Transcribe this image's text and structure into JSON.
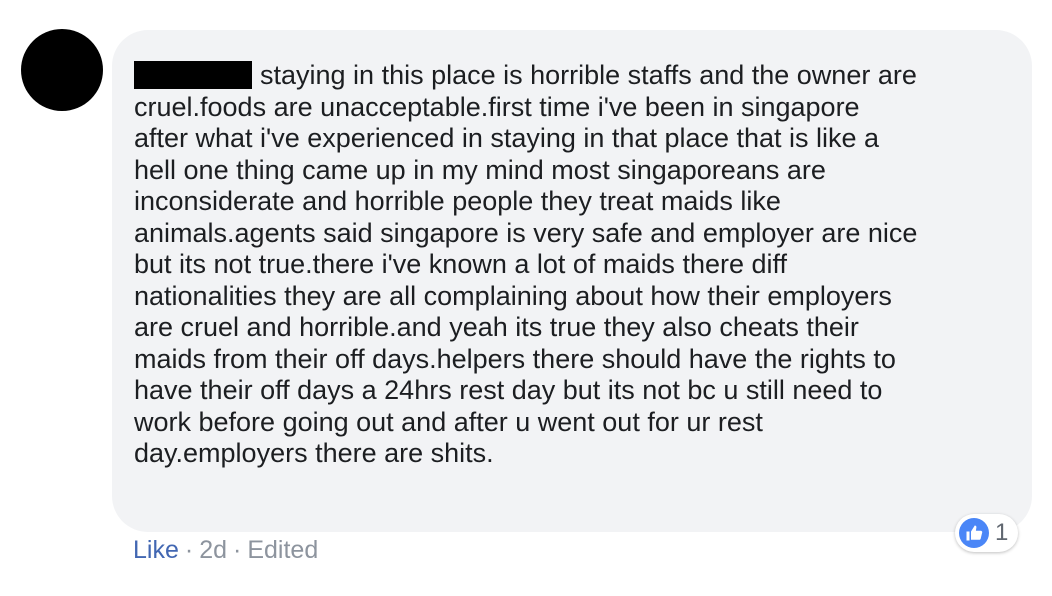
{
  "comment": {
    "author_redacted": true,
    "text": "staying in this place is horrible staffs and the owner are\ncruel.foods are unacceptable.first time i've been in singapore\nafter what i've experienced in staying in that place that is like a\nhell one thing came up in my mind most singaporeans are\ninconsiderate and horrible people they treat maids like\nanimals.agents said singapore is very safe and employer are nice\nbut its not true.there i've known a lot of maids there diff\nnationalities they are all complaining about how their employers\nare cruel and horrible.and yeah its true they also cheats their\nmaids from their off days.helpers there should have the rights to\nhave their off days a 24hrs rest day but its not bc u still need to\nwork before going out and after u went out for ur rest\nday.employers there are shits."
  },
  "reactions": {
    "icon": "thumbs-up-icon",
    "count": "1"
  },
  "actions": {
    "like_label": "Like",
    "separator": "·",
    "time": "2d",
    "edited_label": "Edited"
  },
  "colors": {
    "bubble": "#f2f3f5",
    "text": "#1c1e21",
    "link": "#4267b2",
    "meta": "#8d949e",
    "like_badge": "#4a86f7"
  }
}
